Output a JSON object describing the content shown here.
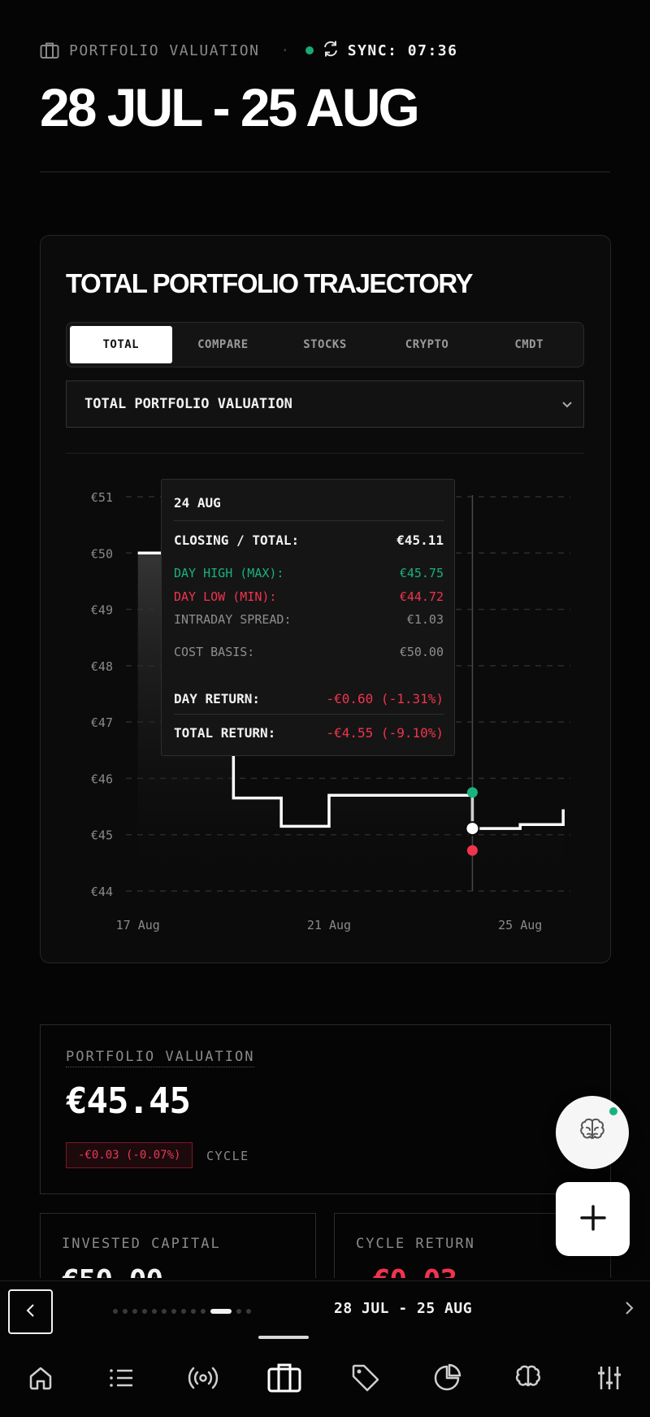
{
  "header": {
    "section_label": "PORTFOLIO VALUATION",
    "separator": "·",
    "sync_label": "SYNC: 07:36",
    "title": "28 JUL - 25 AUG"
  },
  "chart_card": {
    "title": "TOTAL PORTFOLIO TRAJECTORY",
    "tabs": [
      "TOTAL",
      "COMPARE",
      "STOCKS",
      "CRYPTO",
      "CMDT"
    ],
    "active_tab": "TOTAL",
    "select_value": "TOTAL PORTFOLIO VALUATION"
  },
  "tooltip": {
    "date": "24 AUG",
    "closing_label": "CLOSING / TOTAL:",
    "closing_value": "€45.11",
    "high_label": "DAY HIGH (MAX):",
    "high_value": "€45.75",
    "low_label": "DAY LOW (MIN):",
    "low_value": "€44.72",
    "spread_label": "INTRADAY SPREAD:",
    "spread_value": "€1.03",
    "basis_label": "COST BASIS:",
    "basis_value": "€50.00",
    "day_return_label": "DAY RETURN:",
    "day_return_value": "-€0.60 (-1.31%)",
    "total_return_label": "TOTAL RETURN:",
    "total_return_value": "-€4.55 (-9.10%)"
  },
  "chart_data": {
    "type": "line",
    "title": "",
    "xlabel": "",
    "ylabel": "",
    "ylim": [
      44,
      51
    ],
    "y_ticks": [
      "€44",
      "€45",
      "€46",
      "€47",
      "€48",
      "€49",
      "€50",
      "€51"
    ],
    "x_ticks": [
      {
        "label": "17 Aug",
        "x": 17
      },
      {
        "label": "21 Aug",
        "x": 21
      },
      {
        "label": "25 Aug",
        "x": 25
      }
    ],
    "step": true,
    "grid": true,
    "x": [
      17,
      18,
      19,
      20,
      21,
      22,
      23,
      24,
      24.3,
      25,
      25.9
    ],
    "series": [
      {
        "values": [
          50.0,
          50.0,
          45.65,
          45.15,
          45.7,
          45.7,
          45.7,
          45.11,
          45.11,
          45.18,
          45.45
        ]
      }
    ],
    "highlight": {
      "x": 24,
      "close": 45.11,
      "high": 45.75,
      "low": 44.72
    },
    "colors": {
      "line": "#ffffff",
      "high_marker": "#19b27c",
      "low_marker": "#f0344e"
    }
  },
  "valuation": {
    "label": "PORTFOLIO VALUATION",
    "amount": "€45.45",
    "change": "-€0.03 (-0.07%)",
    "cycle_label": "CYCLE"
  },
  "mini_cards": {
    "invested_label": "INVESTED CAPITAL",
    "invested_value": "€50.00",
    "cycle_return_label": "CYCLE RETURN",
    "cycle_return_value": "-€0.03"
  },
  "pager": {
    "label": "28 JUL - 25 AUG",
    "page_count": 13,
    "active_index": 10
  },
  "nav": {
    "items": [
      "home-icon",
      "list-icon",
      "broadcast-icon",
      "briefcase-icon",
      "tag-icon",
      "pie-chart-icon",
      "brain-icon",
      "sliders-icon"
    ],
    "active": "briefcase-icon"
  },
  "colors": {
    "background": "#050505",
    "positive": "#19b27c",
    "negative": "#f0344e"
  }
}
